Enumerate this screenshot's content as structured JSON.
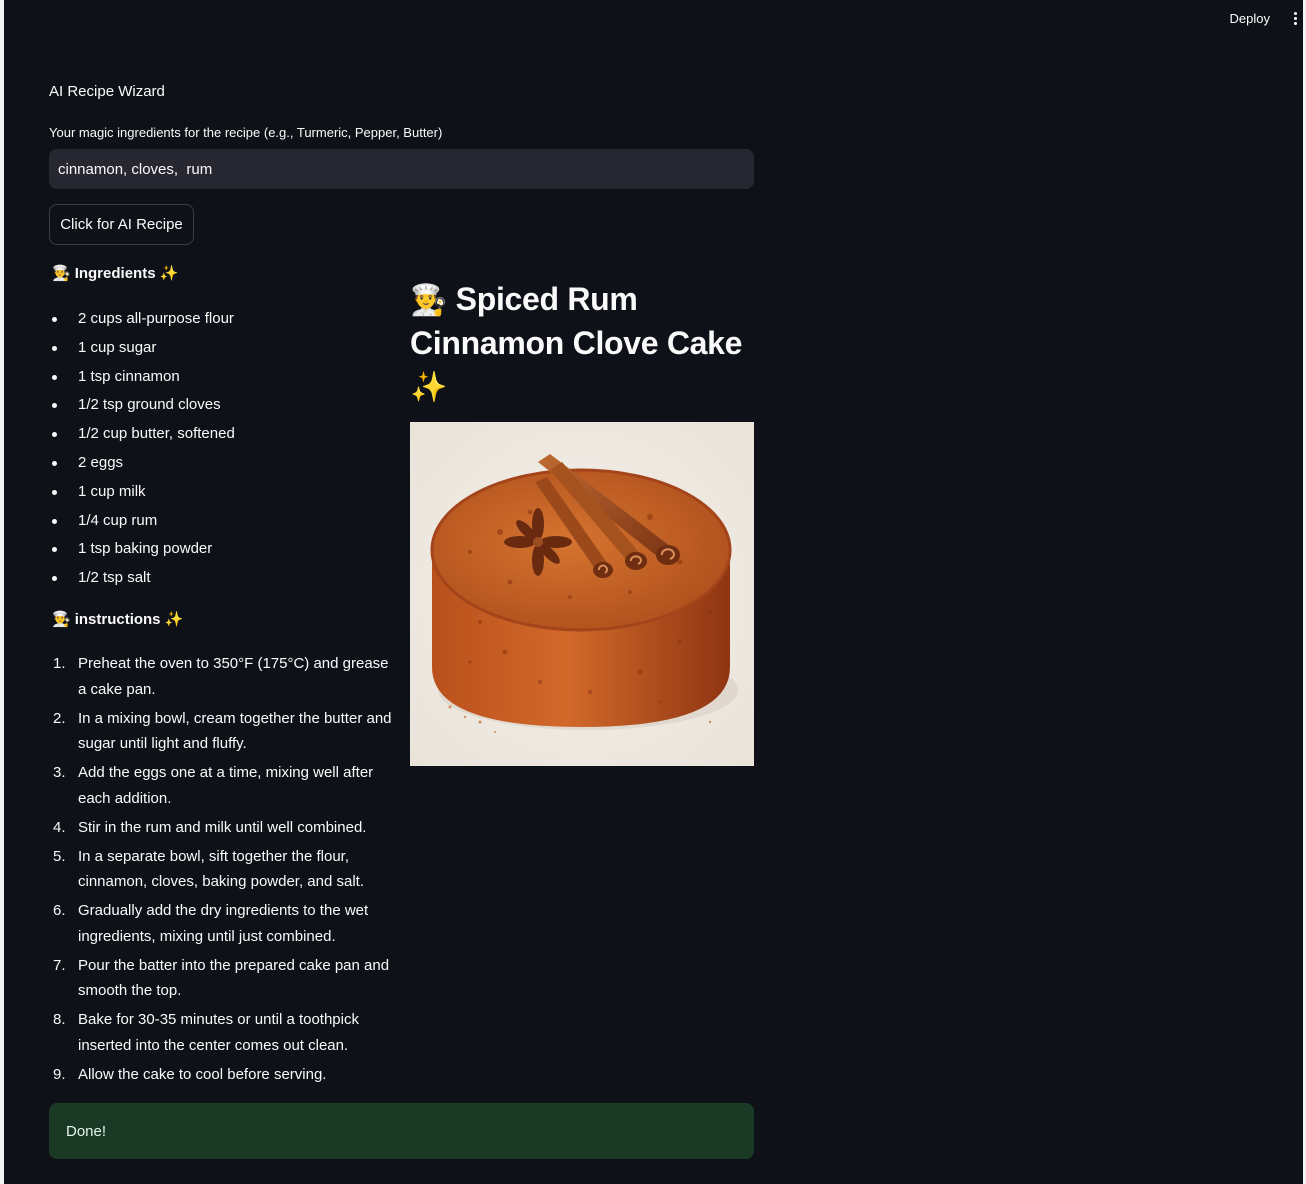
{
  "header": {
    "deploy_label": "Deploy",
    "menu_icon": "kebab-menu-icon"
  },
  "app": {
    "title": "AI Recipe Wizard",
    "input_label": "Your magic ingredients for the recipe (e.g., Turmeric, Pepper, Butter)",
    "input_value": "cinnamon, cloves,  rum",
    "button_label": "Click for AI Recipe"
  },
  "ingredients": {
    "heading_icon": "chef-emoji",
    "heading": "Ingredients",
    "heading_trail_icon": "sparkles-emoji",
    "items": [
      "2 cups all-purpose flour",
      "1 cup sugar",
      "1 tsp cinnamon",
      "1/2 tsp ground cloves",
      "1/2 cup butter, softened",
      "2 eggs",
      "1 cup milk",
      "1/4 cup rum",
      "1 tsp baking powder",
      "1/2 tsp salt"
    ]
  },
  "instructions": {
    "heading": "instructions",
    "steps": [
      {
        "num": "1.",
        "text": "Preheat the oven to 350°F (175°C) and grease a cake pan."
      },
      {
        "num": "2.",
        "text": "In a mixing bowl, cream together the butter and sugar until light and fluffy."
      },
      {
        "num": "3.",
        "text": "Add the eggs one at a time, mixing well after each addition."
      },
      {
        "num": "4.",
        "text": "Stir in the rum and milk until well combined."
      },
      {
        "num": "5.",
        "text": "In a separate bowl, sift together the flour, cinnamon, cloves, baking powder, and salt."
      },
      {
        "num": "6.",
        "text": "Gradually add the dry ingredients to the wet ingredients, mixing until just combined."
      },
      {
        "num": "7.",
        "text": "Pour the batter into the prepared cake pan and smooth the top."
      },
      {
        "num": "8.",
        "text": "Bake for 30-35 minutes or until a toothpick inserted into the center comes out clean."
      },
      {
        "num": "9.",
        "text": "Allow the cake to cool before serving."
      }
    ]
  },
  "recipe": {
    "title": "Spiced Rum Cinnamon Clove Cake",
    "image_subject": "spiced-cake-with-cinnamon-sticks-and-star-anise"
  },
  "status": {
    "message": "Done!",
    "color": "#1a3a25"
  },
  "colors": {
    "background": "#0e1117",
    "input_background": "#262730",
    "text": "#fafafa"
  }
}
